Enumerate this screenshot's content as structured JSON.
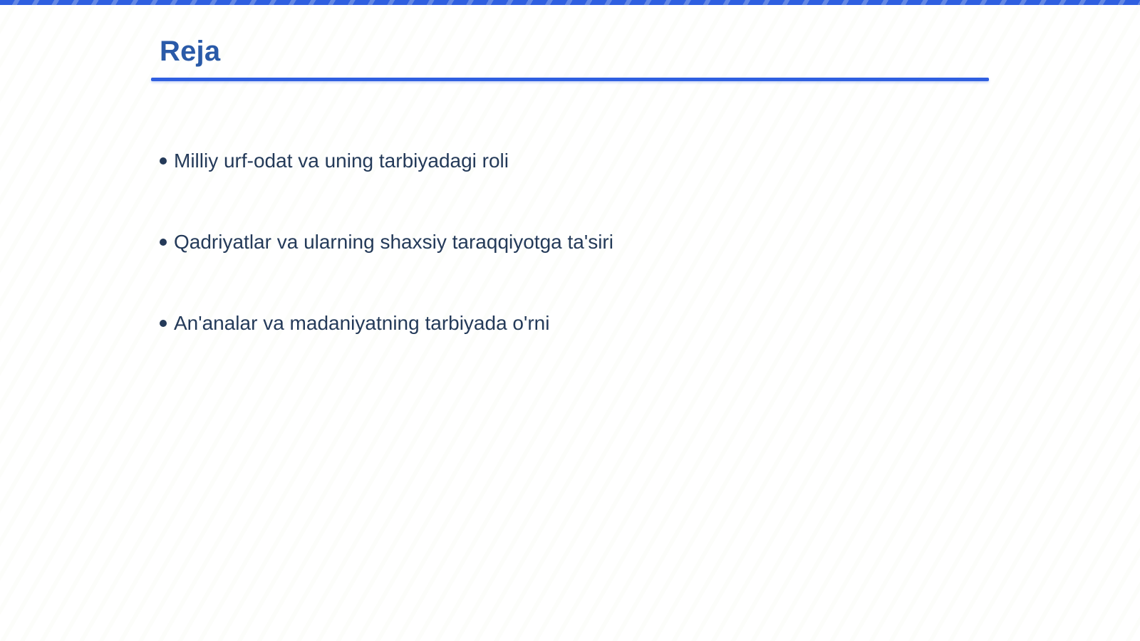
{
  "slide": {
    "title": "Reja",
    "bullets": [
      "Milliy urf-odat va uning tarbiyadagi roli",
      "Qadriyatlar va ularning shaxsiy taraqqiyotga ta'siri",
      "An'analar va madaniyatning tarbiyada o'rni"
    ]
  },
  "colors": {
    "accent": "#2f5fe0",
    "title": "#2a5aa8",
    "text": "#243a59",
    "background": "#ffffff"
  }
}
